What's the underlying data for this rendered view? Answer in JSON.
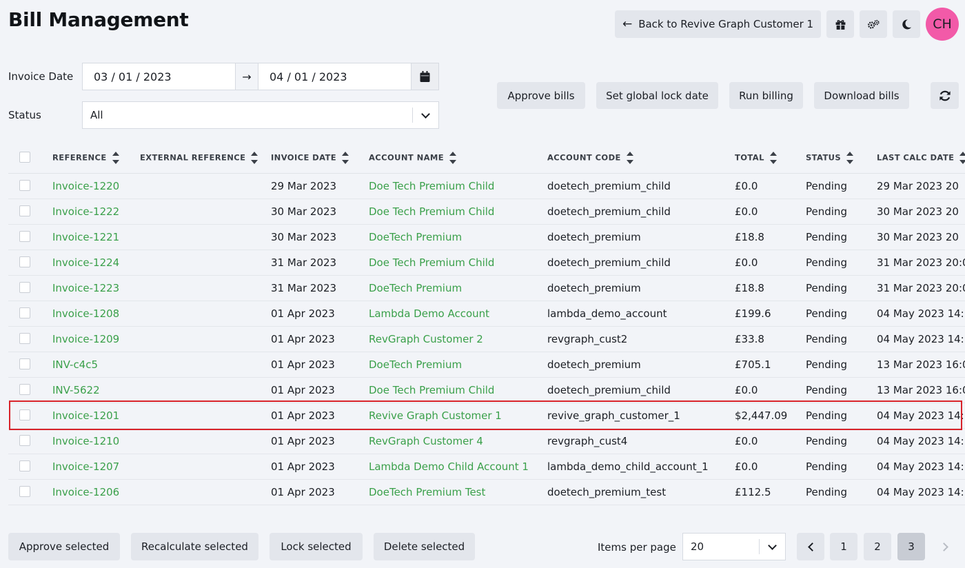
{
  "header": {
    "title": "Bill Management",
    "back_label": "Back to Revive Graph Customer 1",
    "avatar_initials": "CH"
  },
  "filters": {
    "invoice_date_label": "Invoice Date",
    "date_from": "03 / 01 / 2023",
    "date_to": "04 / 01 / 2023",
    "status_label": "Status",
    "status_value": "All"
  },
  "actions": {
    "approve_bills": "Approve bills",
    "set_global_lock_date": "Set global lock date",
    "run_billing": "Run billing",
    "download_bills": "Download bills"
  },
  "table": {
    "columns": [
      "REFERENCE",
      "EXTERNAL REFERENCE",
      "INVOICE DATE",
      "ACCOUNT NAME",
      "ACCOUNT CODE",
      "TOTAL",
      "STATUS",
      "LAST CALC DATE"
    ],
    "rows": [
      {
        "reference": "Invoice-1220",
        "external": "",
        "invoice_date": "29 Mar 2023",
        "account_name": "Doe Tech Premium Child",
        "account_code": "doetech_premium_child",
        "total": "£0.0",
        "status": "Pending",
        "last_calc": "29 Mar 2023 20"
      },
      {
        "reference": "Invoice-1222",
        "external": "",
        "invoice_date": "30 Mar 2023",
        "account_name": "Doe Tech Premium Child",
        "account_code": "doetech_premium_child",
        "total": "£0.0",
        "status": "Pending",
        "last_calc": "30 Mar 2023 20"
      },
      {
        "reference": "Invoice-1221",
        "external": "",
        "invoice_date": "30 Mar 2023",
        "account_name": "DoeTech Premium",
        "account_code": "doetech_premium",
        "total": "£18.8",
        "status": "Pending",
        "last_calc": "30 Mar 2023 20"
      },
      {
        "reference": "Invoice-1224",
        "external": "",
        "invoice_date": "31 Mar 2023",
        "account_name": "Doe Tech Premium Child",
        "account_code": "doetech_premium_child",
        "total": "£0.0",
        "status": "Pending",
        "last_calc": "31 Mar 2023 20:0"
      },
      {
        "reference": "Invoice-1223",
        "external": "",
        "invoice_date": "31 Mar 2023",
        "account_name": "DoeTech Premium",
        "account_code": "doetech_premium",
        "total": "£18.8",
        "status": "Pending",
        "last_calc": "31 Mar 2023 20:0"
      },
      {
        "reference": "Invoice-1208",
        "external": "",
        "invoice_date": "01 Apr 2023",
        "account_name": "Lambda Demo Account",
        "account_code": "lambda_demo_account",
        "total": "£199.6",
        "status": "Pending",
        "last_calc": "04 May 2023 14:"
      },
      {
        "reference": "Invoice-1209",
        "external": "",
        "invoice_date": "01 Apr 2023",
        "account_name": "RevGraph Customer 2",
        "account_code": "revgraph_cust2",
        "total": "£33.8",
        "status": "Pending",
        "last_calc": "04 May 2023 14:"
      },
      {
        "reference": "INV-c4c5",
        "external": "",
        "invoice_date": "01 Apr 2023",
        "account_name": "DoeTech Premium",
        "account_code": "doetech_premium",
        "total": "£705.1",
        "status": "Pending",
        "last_calc": "13 Mar 2023 16:0"
      },
      {
        "reference": "INV-5622",
        "external": "",
        "invoice_date": "01 Apr 2023",
        "account_name": "Doe Tech Premium Child",
        "account_code": "doetech_premium_child",
        "total": "£0.0",
        "status": "Pending",
        "last_calc": "13 Mar 2023 16:0"
      },
      {
        "reference": "Invoice-1201",
        "external": "",
        "invoice_date": "01 Apr 2023",
        "account_name": "Revive Graph Customer 1",
        "account_code": "revive_graph_customer_1",
        "total": "$2,447.09",
        "status": "Pending",
        "last_calc": "04 May 2023 14:"
      },
      {
        "reference": "Invoice-1210",
        "external": "",
        "invoice_date": "01 Apr 2023",
        "account_name": "RevGraph Customer 4",
        "account_code": "revgraph_cust4",
        "total": "£0.0",
        "status": "Pending",
        "last_calc": "04 May 2023 14:"
      },
      {
        "reference": "Invoice-1207",
        "external": "",
        "invoice_date": "01 Apr 2023",
        "account_name": "Lambda Demo Child Account 1",
        "account_code": "lambda_demo_child_account_1",
        "total": "£0.0",
        "status": "Pending",
        "last_calc": "04 May 2023 14:"
      },
      {
        "reference": "Invoice-1206",
        "external": "",
        "invoice_date": "01 Apr 2023",
        "account_name": "DoeTech Premium Test",
        "account_code": "doetech_premium_test",
        "total": "£112.5",
        "status": "Pending",
        "last_calc": "04 May 2023 14:"
      }
    ]
  },
  "footer": {
    "approve_selected": "Approve selected",
    "recalculate_selected": "Recalculate selected",
    "lock_selected": "Lock selected",
    "delete_selected": "Delete selected",
    "items_per_page_label": "Items per page",
    "items_per_page_value": "20",
    "pages": [
      "1",
      "2",
      "3"
    ],
    "current_page": "3"
  },
  "colors": {
    "link": "#3aa04a",
    "avatar": "#f25aa8",
    "highlight": "#d8232a"
  }
}
